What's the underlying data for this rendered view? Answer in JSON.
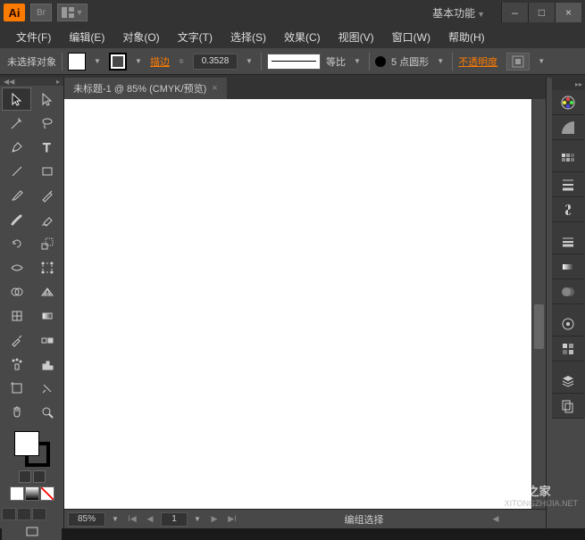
{
  "app": {
    "logo": "Ai"
  },
  "titlebar": {
    "workspace": "基本功能"
  },
  "window_controls": {
    "minimize": "–",
    "maximize": "□",
    "close": "×"
  },
  "menu": {
    "file": "文件(F)",
    "edit": "编辑(E)",
    "object": "对象(O)",
    "text": "文字(T)",
    "select": "选择(S)",
    "effect": "效果(C)",
    "view": "视图(V)",
    "window": "窗口(W)",
    "help": "帮助(H)"
  },
  "controlbar": {
    "no_selection": "未选择对象",
    "stroke_label": "描边",
    "stroke_weight": "0.3528",
    "ratio_label": "等比",
    "brush_value": "5 点圆形",
    "opacity_label": "不透明度"
  },
  "document": {
    "tab_title": "未标题-1 @ 85% (CMYK/预览)",
    "tab_close": "×"
  },
  "statusbar": {
    "zoom": "85%",
    "page": "1",
    "mode_text": "编组选择"
  },
  "watermark": {
    "cn": "系统之家",
    "en": "XITONGZHIJIA.NET"
  }
}
